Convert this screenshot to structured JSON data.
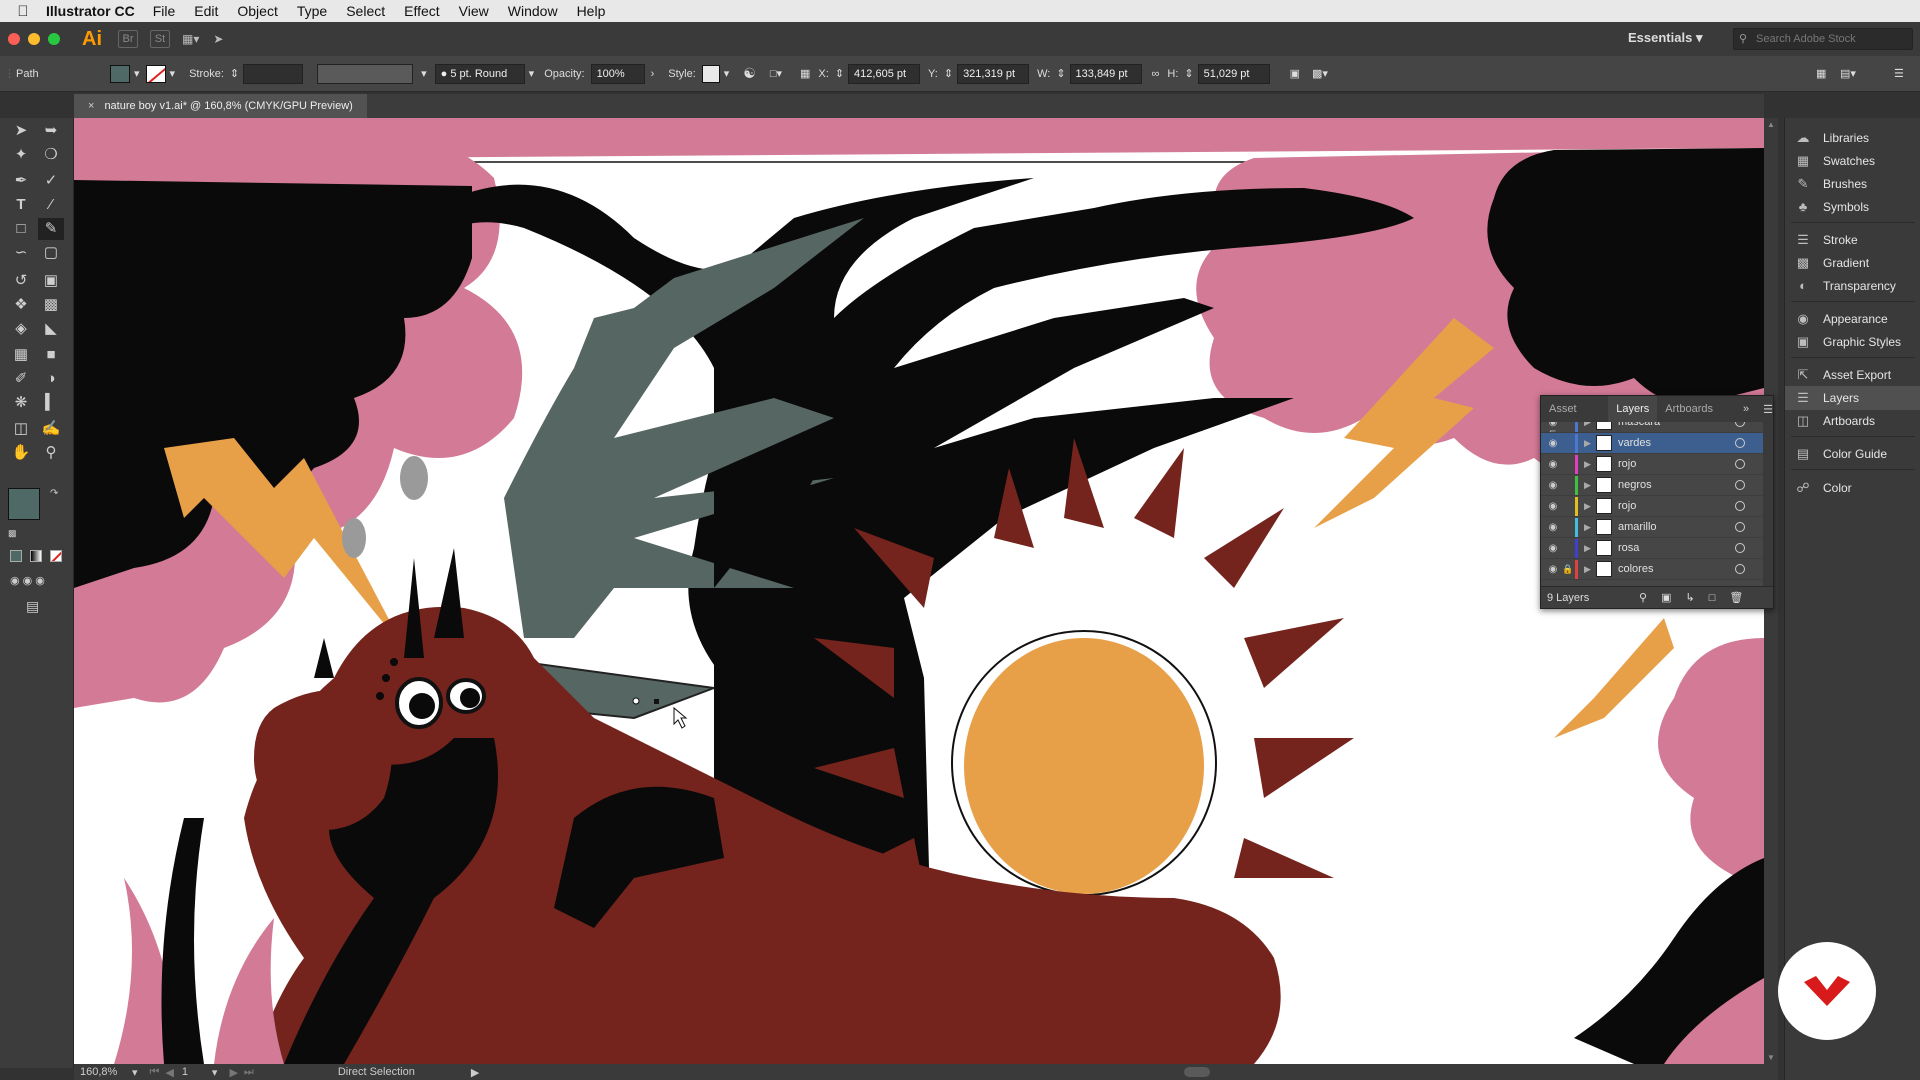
{
  "menubar": {
    "app_name": "Illustrator CC",
    "items": [
      "File",
      "Edit",
      "Object",
      "Type",
      "Select",
      "Effect",
      "View",
      "Window",
      "Help"
    ]
  },
  "appbar": {
    "logo": "Ai",
    "workspace": "Essentials",
    "stock_search_placeholder": "Search Adobe Stock"
  },
  "control": {
    "selection_type": "Path",
    "stroke_label": "Stroke:",
    "brush": "5 pt. Round",
    "opacity_label": "Opacity:",
    "opacity": "100%",
    "style_label": "Style:",
    "x_label": "X:",
    "x": "412,605 pt",
    "y_label": "Y:",
    "y": "321,319 pt",
    "w_label": "W:",
    "w": "133,849 pt",
    "h_label": "H:",
    "h": "51,029 pt",
    "fill_color": "#4f6a66"
  },
  "document": {
    "tab_title": "nature boy v1.ai* @ 160,8% (CMYK/GPU Preview)"
  },
  "status": {
    "zoom": "160,8%",
    "page": "1",
    "tool": "Direct Selection"
  },
  "dock": {
    "items": [
      "Libraries",
      "Swatches",
      "Brushes",
      "Symbols",
      "Stroke",
      "Gradient",
      "Transparency",
      "Appearance",
      "Graphic Styles",
      "Asset Export",
      "Layers",
      "Artboards",
      "Color Guide",
      "Color"
    ]
  },
  "layers_panel": {
    "tabs": [
      "Asset Expo",
      "Layers",
      "Artboards"
    ],
    "layers": [
      {
        "name": "mascara",
        "color": "#4a78d0",
        "locked": false
      },
      {
        "name": "vardes",
        "color": "#4a78d0",
        "locked": false,
        "selected": true
      },
      {
        "name": "rojo",
        "color": "#e040c0",
        "locked": false
      },
      {
        "name": "negros",
        "color": "#40c040",
        "locked": false
      },
      {
        "name": "rojo",
        "color": "#e0c020",
        "locked": false
      },
      {
        "name": "amarillo",
        "color": "#40c0e0",
        "locked": false
      },
      {
        "name": "rosa",
        "color": "#4040d0",
        "locked": false
      },
      {
        "name": "colores",
        "color": "#e04040",
        "locked": true
      }
    ],
    "count": "9 Layers"
  },
  "art_colors": {
    "pink": "#d27a96",
    "black": "#0a0a0a",
    "maroon": "#74241d",
    "orange": "#e8a048",
    "gray_green": "#566663",
    "light_gray": "#9a9a9a"
  }
}
